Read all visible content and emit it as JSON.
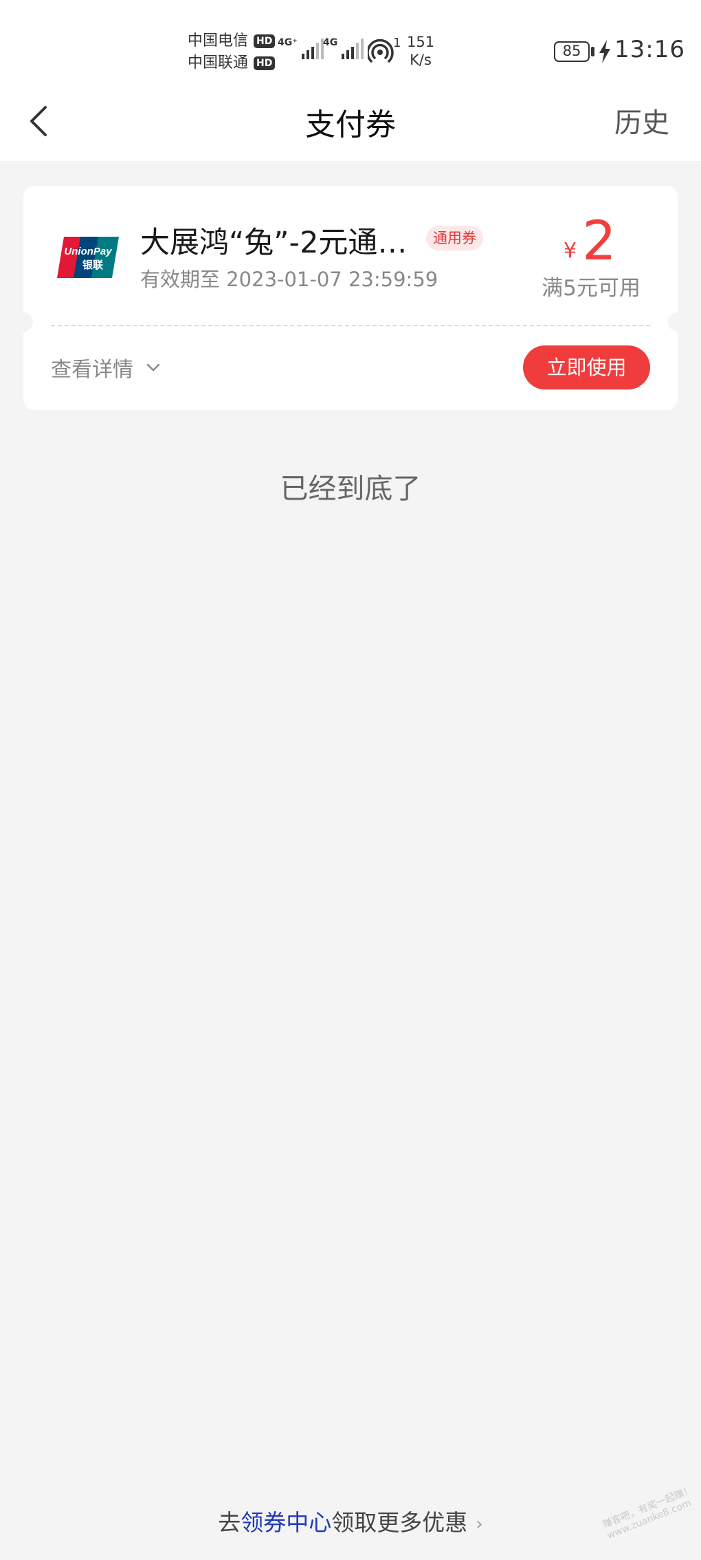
{
  "status_bar": {
    "carrier_1": "中国电信",
    "carrier_2": "中国联通",
    "hd_label": "HD",
    "net_1": "4G⁺",
    "net_2": "4G",
    "hotspot_count": "1",
    "speed_value": "151",
    "speed_unit": "K/s",
    "battery": "85",
    "time": "13:16"
  },
  "header": {
    "title": "支付券",
    "history_label": "历史"
  },
  "coupon": {
    "title": "大展鸿“兔”-2元通…",
    "badge": "通用券",
    "validity": "有效期至 2023-01-07 23:59:59",
    "currency": "¥",
    "amount": "2",
    "threshold": "满5元可用",
    "details_label": "查看详情",
    "use_label": "立即使用",
    "logo_text": "UnionPay",
    "logo_text_cn": "银联"
  },
  "list_end": "已经到底了",
  "footer": {
    "prefix": "去",
    "link": "领券中心",
    "suffix": "领取更多优惠"
  },
  "watermark": {
    "line1": "赚客吧，有奖一起赚！",
    "line2": "www.zuanke8.com"
  },
  "colors": {
    "accent": "#f03c3c",
    "link": "#1f3ab8",
    "page_bg": "#f4f4f4"
  }
}
